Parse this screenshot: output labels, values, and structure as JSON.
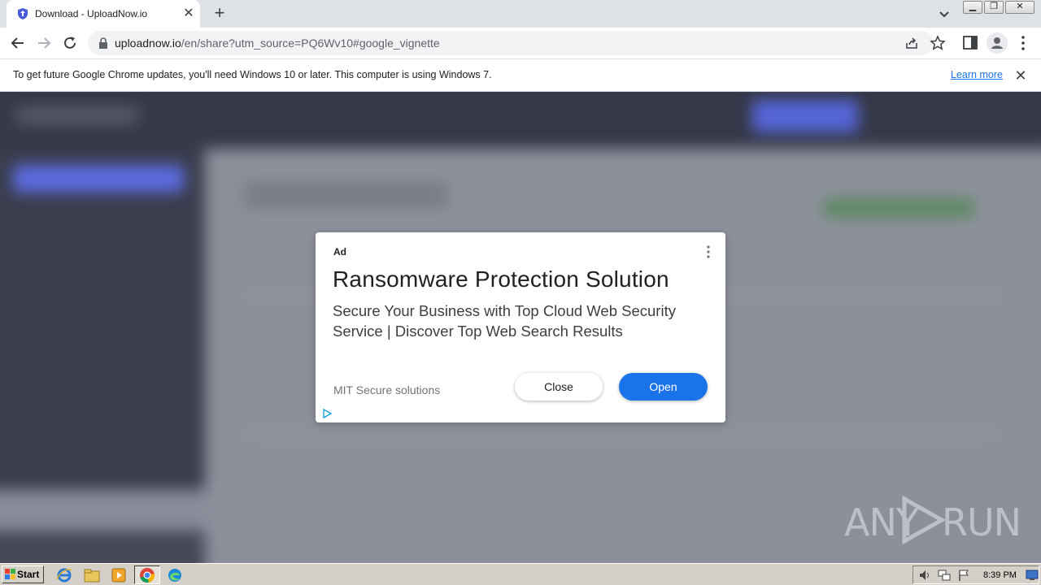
{
  "browser": {
    "tab": {
      "title": "Download - UploadNow.io"
    },
    "url": {
      "host": "uploadnow.io",
      "path": "/en/share?utm_source=PQ6Wv10#google_vignette"
    },
    "infobar": {
      "message": "To get future Google Chrome updates, you'll need Windows 10 or later. This computer is using Windows 7.",
      "link": "Learn more"
    }
  },
  "ad": {
    "label": "Ad",
    "title": "Ransomware Protection Solution",
    "description": "Secure Your Business with Top Cloud Web Security Service | Discover Top Web Search Results",
    "advertiser": "MIT Secure solutions",
    "close_label": "Close",
    "open_label": "Open"
  },
  "watermark": {
    "left": "ANY",
    "right": "RUN"
  },
  "taskbar": {
    "start_label": "Start",
    "clock": "8:39 PM"
  },
  "colors": {
    "accent_blue": "#1a73e8",
    "page_blur": "#8a8d99",
    "sidebar_dark": "#3a3d4c"
  }
}
